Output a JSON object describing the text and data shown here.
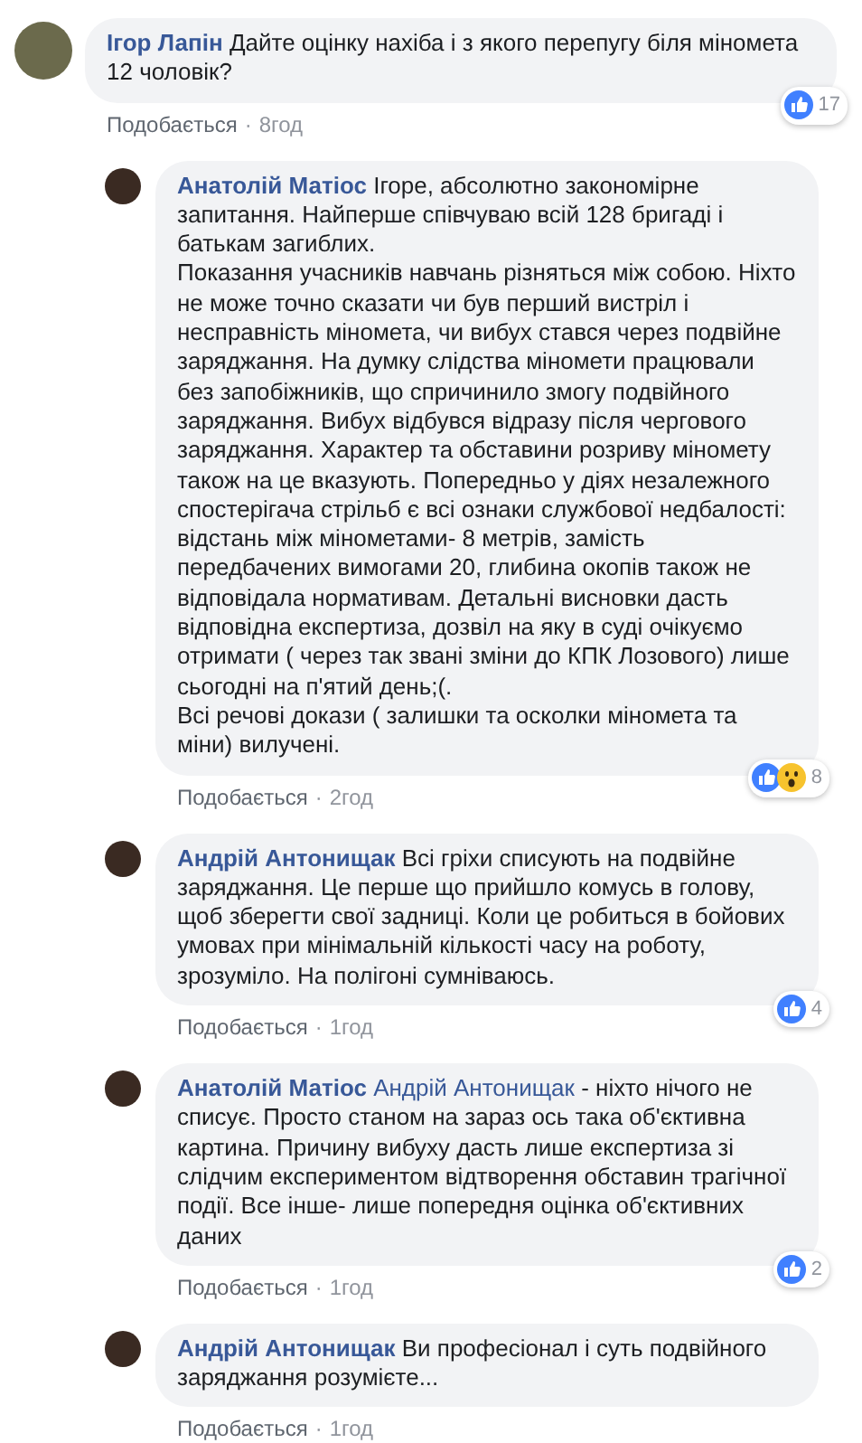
{
  "comments": [
    {
      "author": "Ігор Лапін",
      "text": "Дайте оцінку нахіба і з якого перепугу біля міномета 12 чоловік?",
      "like_label": "Подобається",
      "time": "8год",
      "separator": "·",
      "reactions": [
        {
          "kind": "like"
        }
      ],
      "reaction_count": "17",
      "replies": [
        {
          "author": "Анатолій Матіос",
          "text": "Ігоре, абсолютно закономірне запитання. Найперше співчуваю всій 128 бригаді і батькам загиблих.\nПоказання учасників навчань різняться між собою. Ніхто не може точно сказати чи був перший вистріл і несправність міномета, чи вибух стався через подвійне заряджання. На думку слідства міномети працювали без запобіжників, що спричинило змогу подвійного заряджання. Вибух відбувся відразу після чергового заряджання. Характер та обставини розриву міномету також на це вказують. Попередньо у діях незалежного спостерігача стрільб є всі ознаки службової недбалості: відстань між мінометами- 8 метрів, замість передбачених вимогами 20, глибина окопів також не відповідала нормативам. Детальні висновки дасть відповідна експертиза, дозвіл на яку в суді очікуємо отримати ( через так звані зміни до КПК Лозового) лише сьогодні на п'ятий день;(.\nВсі речові докази ( залишки та осколки міномета та міни) вилучені.",
          "like_label": "Подобається",
          "time": "2год",
          "separator": "·",
          "reactions": [
            {
              "kind": "like"
            },
            {
              "kind": "wow"
            }
          ],
          "reaction_count": "8"
        },
        {
          "author": "Андрій Антонищак",
          "text": "Всі гріхи списують на подвійне заряджання. Це перше що прийшло комусь в голову, щоб зберегти свої задниці. Коли це робиться в бойових умовах при мінімальній кількості часу на роботу, зрозуміло. На полігоні сумніваюсь.",
          "like_label": "Подобається",
          "time": "1год",
          "separator": "·",
          "reactions": [
            {
              "kind": "like"
            }
          ],
          "reaction_count": "4"
        },
        {
          "author": "Анатолій Матіос",
          "mention": "Андрій Антонищак",
          "text": "- ніхто нічого не списує. Просто станом на зараз ось така об'єктивна картина. Причину вибуху дасть лише експертиза зі слідчим експериментом відтворення обставин трагічної події. Все інше- лише попередня оцінка об'єктивних даних",
          "like_label": "Подобається",
          "time": "1год",
          "separator": "·",
          "reactions": [
            {
              "kind": "like"
            }
          ],
          "reaction_count": "2"
        },
        {
          "author": "Андрій Антонищак",
          "text": "Ви професіонал і суть подвійного заряджання розумієте...",
          "like_label": "Подобається",
          "time": "1год",
          "separator": "·"
        }
      ]
    }
  ]
}
